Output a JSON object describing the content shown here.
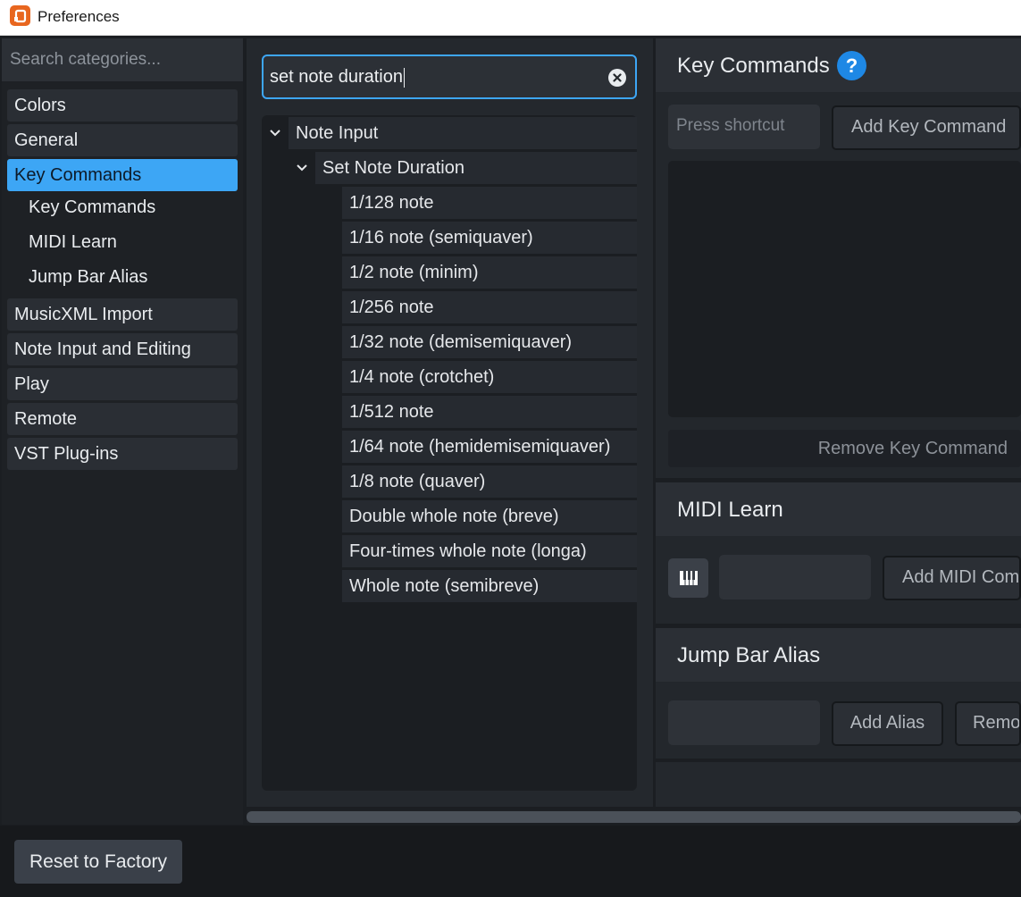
{
  "window": {
    "title": "Preferences"
  },
  "sidebar": {
    "search_placeholder": "Search categories...",
    "items": [
      {
        "label": "Colors"
      },
      {
        "label": "General"
      },
      {
        "label": "Key Commands",
        "active": true
      },
      {
        "label": "Key Commands",
        "sub": true
      },
      {
        "label": "MIDI Learn",
        "sub": true
      },
      {
        "label": "Jump Bar Alias",
        "sub": true
      },
      {
        "label": "MusicXML Import"
      },
      {
        "label": "Note Input and Editing"
      },
      {
        "label": "Play"
      },
      {
        "label": "Remote"
      },
      {
        "label": "VST Plug-ins"
      }
    ]
  },
  "commands": {
    "search_value": "set note duration",
    "tree": {
      "group": "Note Input",
      "subgroup": "Set Note Duration",
      "items": [
        "1/128 note",
        "1/16 note (semiquaver)",
        "1/2 note (minim)",
        "1/256 note",
        "1/32 note (demisemiquaver)",
        "1/4 note (crotchet)",
        "1/512 note",
        "1/64 note (hemidemisemiquaver)",
        "1/8 note (quaver)",
        "Double whole note (breve)",
        "Four-times whole note (longa)",
        "Whole note (semibreve)"
      ]
    }
  },
  "key_commands": {
    "title": "Key Commands",
    "help": "?",
    "shortcut_placeholder": "Press shortcut",
    "add_label": "Add Key Command",
    "remove_label": "Remove Key Command"
  },
  "midi_learn": {
    "title": "MIDI Learn",
    "add_label": "Add MIDI Comm"
  },
  "jump_bar": {
    "title": "Jump Bar Alias",
    "add_label": "Add Alias",
    "remove_label": "Remov"
  },
  "footer": {
    "reset_label": "Reset to Factory"
  },
  "colors": {
    "accent": "#3da6f5",
    "help": "#1e88e5"
  }
}
